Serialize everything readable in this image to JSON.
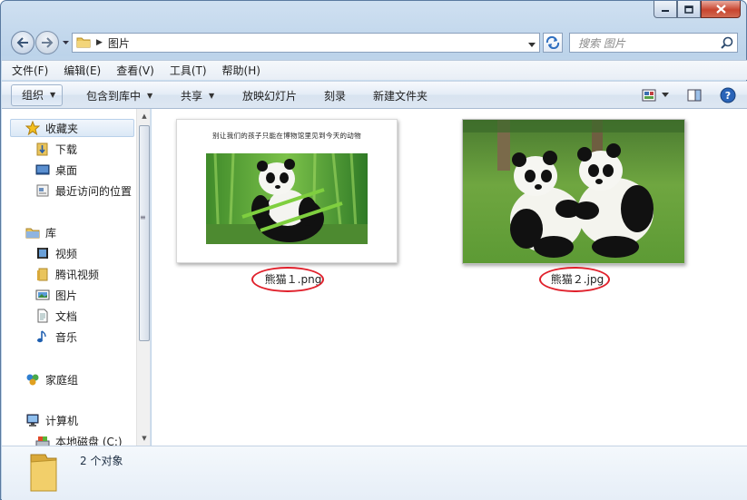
{
  "window": {
    "address_folder": "图片",
    "search_placeholder": "搜索 图片"
  },
  "menu": [
    "文件(F)",
    "编辑(E)",
    "查看(V)",
    "工具(T)",
    "帮助(H)"
  ],
  "toolbar": {
    "organize": "组织",
    "include_in_library": "包含到库中",
    "share": "共享",
    "slideshow": "放映幻灯片",
    "burn": "刻录",
    "new_folder": "新建文件夹"
  },
  "nav": {
    "favorites": "收藏夹",
    "downloads": "下载",
    "desktop": "桌面",
    "recent": "最近访问的位置",
    "libraries": "库",
    "videos": "视频",
    "tencent_video": "腾讯视频",
    "pictures": "图片",
    "documents": "文档",
    "music": "音乐",
    "homegroup": "家庭组",
    "computer": "计算机",
    "local_disk": "本地磁盘 (C:)"
  },
  "files": [
    {
      "name": "熊猫１.png",
      "thumb_caption": "别让我们的孩子只能在博物馆里见到今天的动物"
    },
    {
      "name": "熊猫２.jpg"
    }
  ],
  "details": {
    "count": "2 个对象"
  },
  "colors": {
    "highlight_ring": "#e0202b",
    "accent": "#1e5fb4"
  }
}
